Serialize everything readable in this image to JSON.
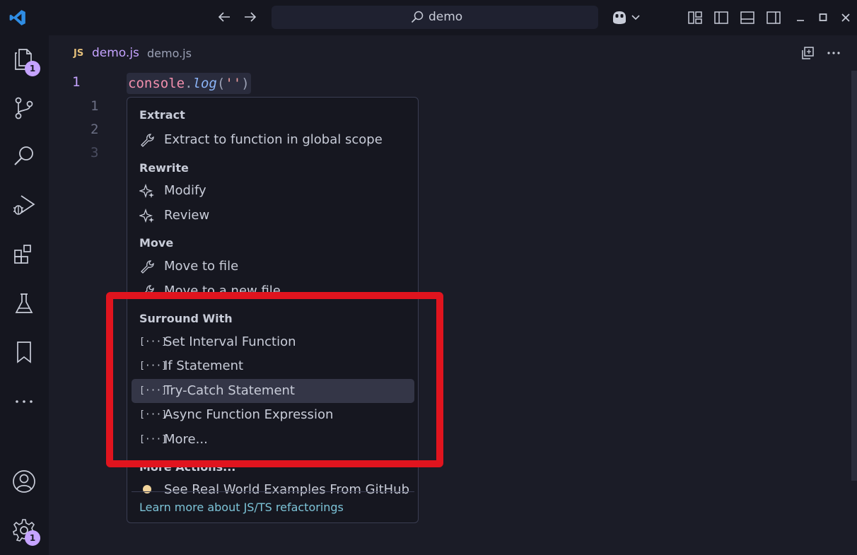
{
  "titlebar": {
    "search_text": "demo"
  },
  "activity": {
    "explorer_badge": "1",
    "settings_badge": "1"
  },
  "editor": {
    "tab_badge": "JS",
    "tab_name": "demo.js",
    "tab_description": "demo.js",
    "active_line": "1",
    "line_numbers": [
      "1",
      "2",
      "3"
    ],
    "code": {
      "object": "console",
      "dot": ".",
      "method": "log",
      "open": "(",
      "string": "''",
      "close": ")"
    }
  },
  "menu": {
    "sections": [
      {
        "header": "Extract",
        "items": [
          {
            "icon": "wrench-icon",
            "label": "Extract to function in global scope"
          }
        ]
      },
      {
        "header": "Rewrite",
        "items": [
          {
            "icon": "sparkle-icon",
            "label": "Modify"
          },
          {
            "icon": "sparkle-icon",
            "label": "Review"
          }
        ]
      },
      {
        "header": "Move",
        "items": [
          {
            "icon": "wrench-icon",
            "label": "Move to file"
          },
          {
            "icon": "wrench-icon",
            "label": "Move to a new file"
          }
        ]
      },
      {
        "header": "Surround With",
        "items": [
          {
            "icon": "snippet-icon",
            "label": "Set Interval Function"
          },
          {
            "icon": "snippet-icon",
            "label": "If Statement"
          },
          {
            "icon": "snippet-icon",
            "label": "Try-Catch Statement",
            "selected": true
          },
          {
            "icon": "snippet-icon",
            "label": "Async Function Expression"
          },
          {
            "icon": "snippet-icon",
            "label": "More..."
          }
        ]
      },
      {
        "header": "More Actions...",
        "items": [
          {
            "icon": "lightbulb-icon",
            "label": "See Real World Examples From GitHub"
          }
        ]
      }
    ],
    "snippet_glyph": "[···]",
    "footer": "Learn more about JS/TS refactorings"
  },
  "colors": {
    "accent": "#c5a3ff",
    "highlight_border": "#e0141e",
    "link": "#7dc4d8"
  }
}
